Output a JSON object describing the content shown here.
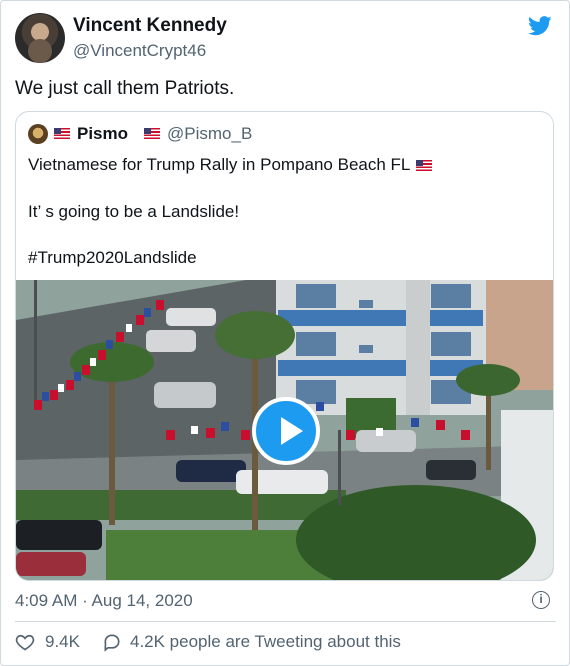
{
  "author": {
    "name": "Vincent Kennedy",
    "handle": "@VincentCrypt46",
    "avatar_icon": "profile-avatar"
  },
  "tweet": {
    "text": "We just call them Patriots."
  },
  "quoted": {
    "name": "Pismo",
    "handle": "@Pismo_B",
    "lines": [
      "Vietnamese for Trump Rally in Pompano Beach FL",
      "It’ s going to be a Landslide!",
      "#Trump2020Landslide"
    ],
    "media_icon": "play-button-icon"
  },
  "timestamp": "4:09 AM · Aug 14, 2020",
  "engagement": {
    "likes": "9.4K",
    "replies_text": "4.2K people are Tweeting about this"
  },
  "colors": {
    "accent": "#1d9bf0",
    "text": "#0f1419",
    "secondary": "#536471",
    "border": "#cfd9de"
  }
}
